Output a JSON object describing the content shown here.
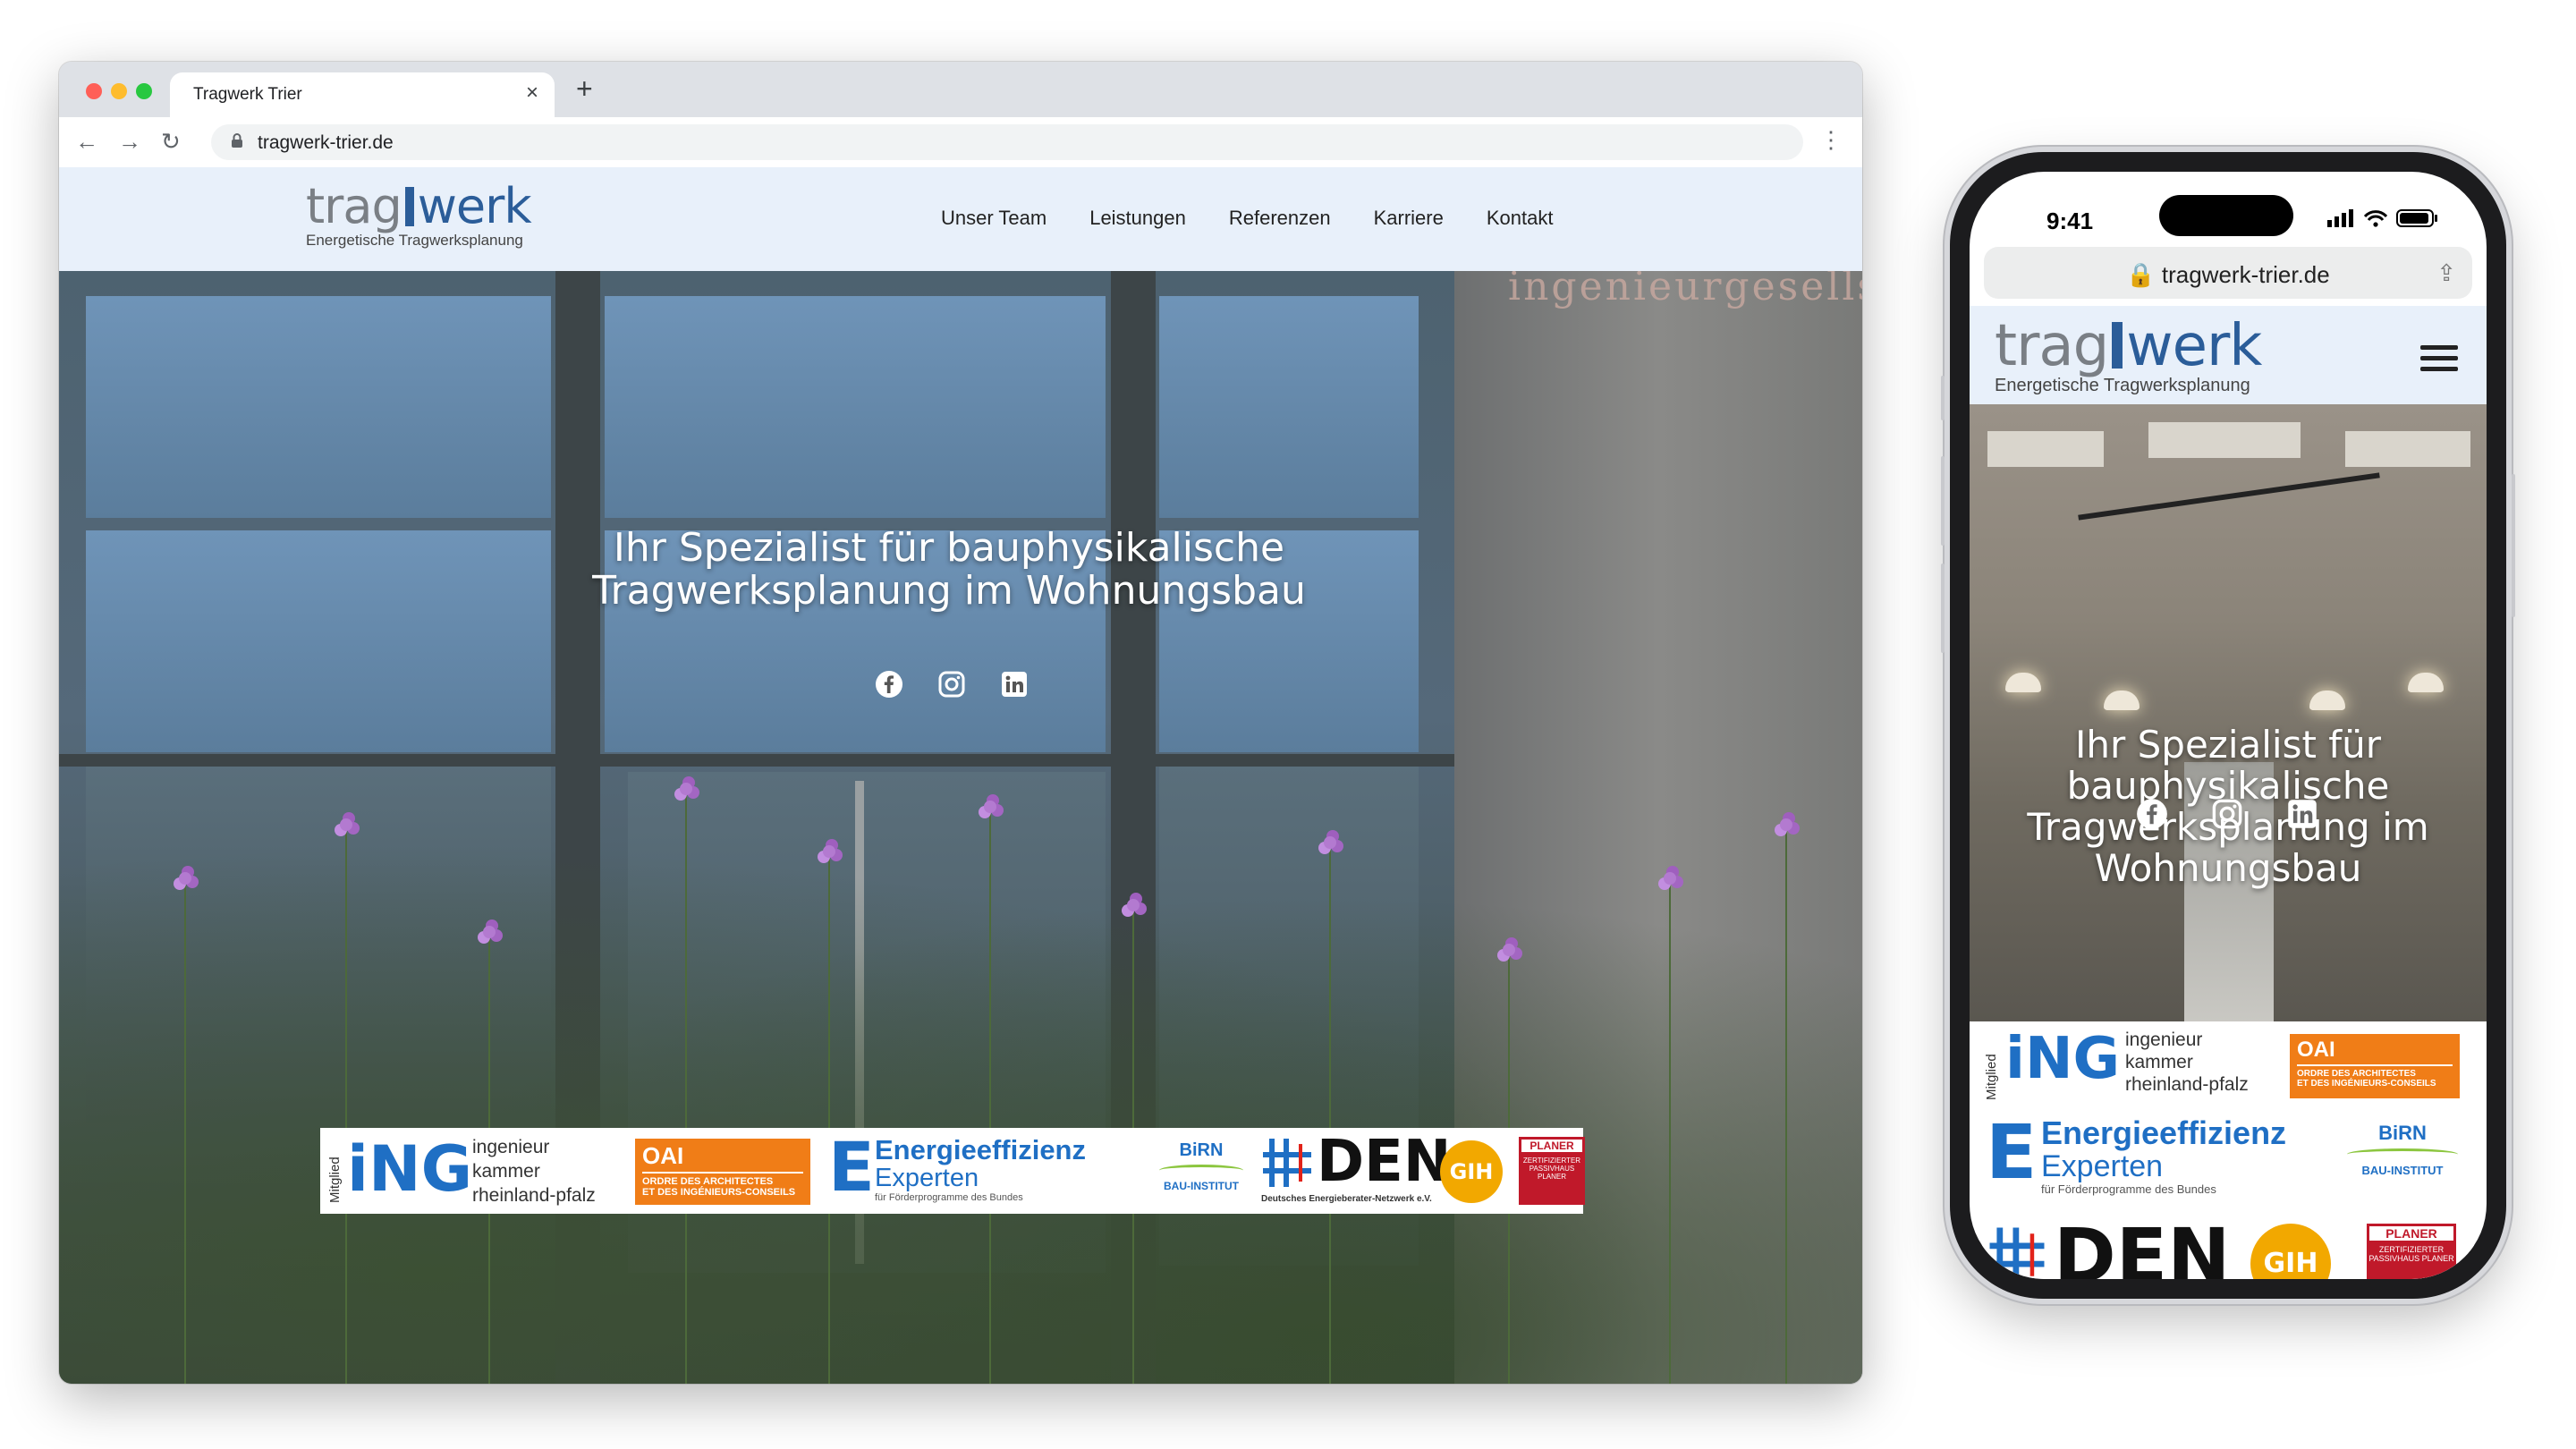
{
  "browser": {
    "tab_title": "Tragwerk Trier",
    "tab_close": "×",
    "new_tab": "+",
    "back": "←",
    "forward": "→",
    "reload": "↻",
    "url": "tragwerk-trier.de",
    "menu": "⋮"
  },
  "site": {
    "logo_left": "trag",
    "logo_right": "werk",
    "logo_tagline": "Energetische Tragwerksplanung",
    "nav": [
      "Unser Team",
      "Leistungen",
      "Referenzen",
      "Karriere",
      "Kontakt"
    ],
    "hero_title_line1": "Ihr Spezialist für bauphysikalische",
    "hero_title_line2": "Tragwerksplanung im Wohnungsbau",
    "wall_script": "ingenieurgesellsc",
    "social_icons": [
      "facebook-icon",
      "instagram-icon",
      "linkedin-icon"
    ]
  },
  "partners": {
    "ing_side": "Mitglied",
    "ing_mark": "iNG",
    "ing_text1": "ingenieur",
    "ing_text2": "kammer",
    "ing_text3": "rheinland-pfalz",
    "oai_mark": "OAI",
    "oai_sub1": "ORDRE DES ARCHITECTES",
    "oai_sub2": "ET DES INGÉNIEURS-CONSEILS",
    "ee_letter": "E",
    "ee_line1": "Energieeffizienz",
    "ee_line2": "Experten",
    "ee_sub": "für Förderprogramme des Bundes",
    "birn_mark": "BiRN",
    "birn_sub": "BAU-INSTITUT",
    "den_mark": "DEN",
    "den_sub": "Deutsches Energieberater-Netzwerk e.V.",
    "gih_mark": "GIH",
    "planer_mark": "PLANER",
    "planer_sub": "ZERTIFIZIERTER PASSIVHAUS PLANER"
  },
  "phone": {
    "time": "9:41",
    "status": "▮▮▮ ◠ ▭",
    "url": "🔒 tragwerk-trier.de",
    "share": "⇪",
    "hero_line1": "Ihr Spezialist für",
    "hero_line2": "bauphysikalische",
    "hero_line3": "Tragwerksplanung im",
    "hero_line4": "Wohnungsbau"
  },
  "colors": {
    "header_bg": "#e8f0fa",
    "brand_blue": "#2b5d99",
    "brand_gray": "#7a7f85",
    "oai_orange": "#f07d17"
  }
}
